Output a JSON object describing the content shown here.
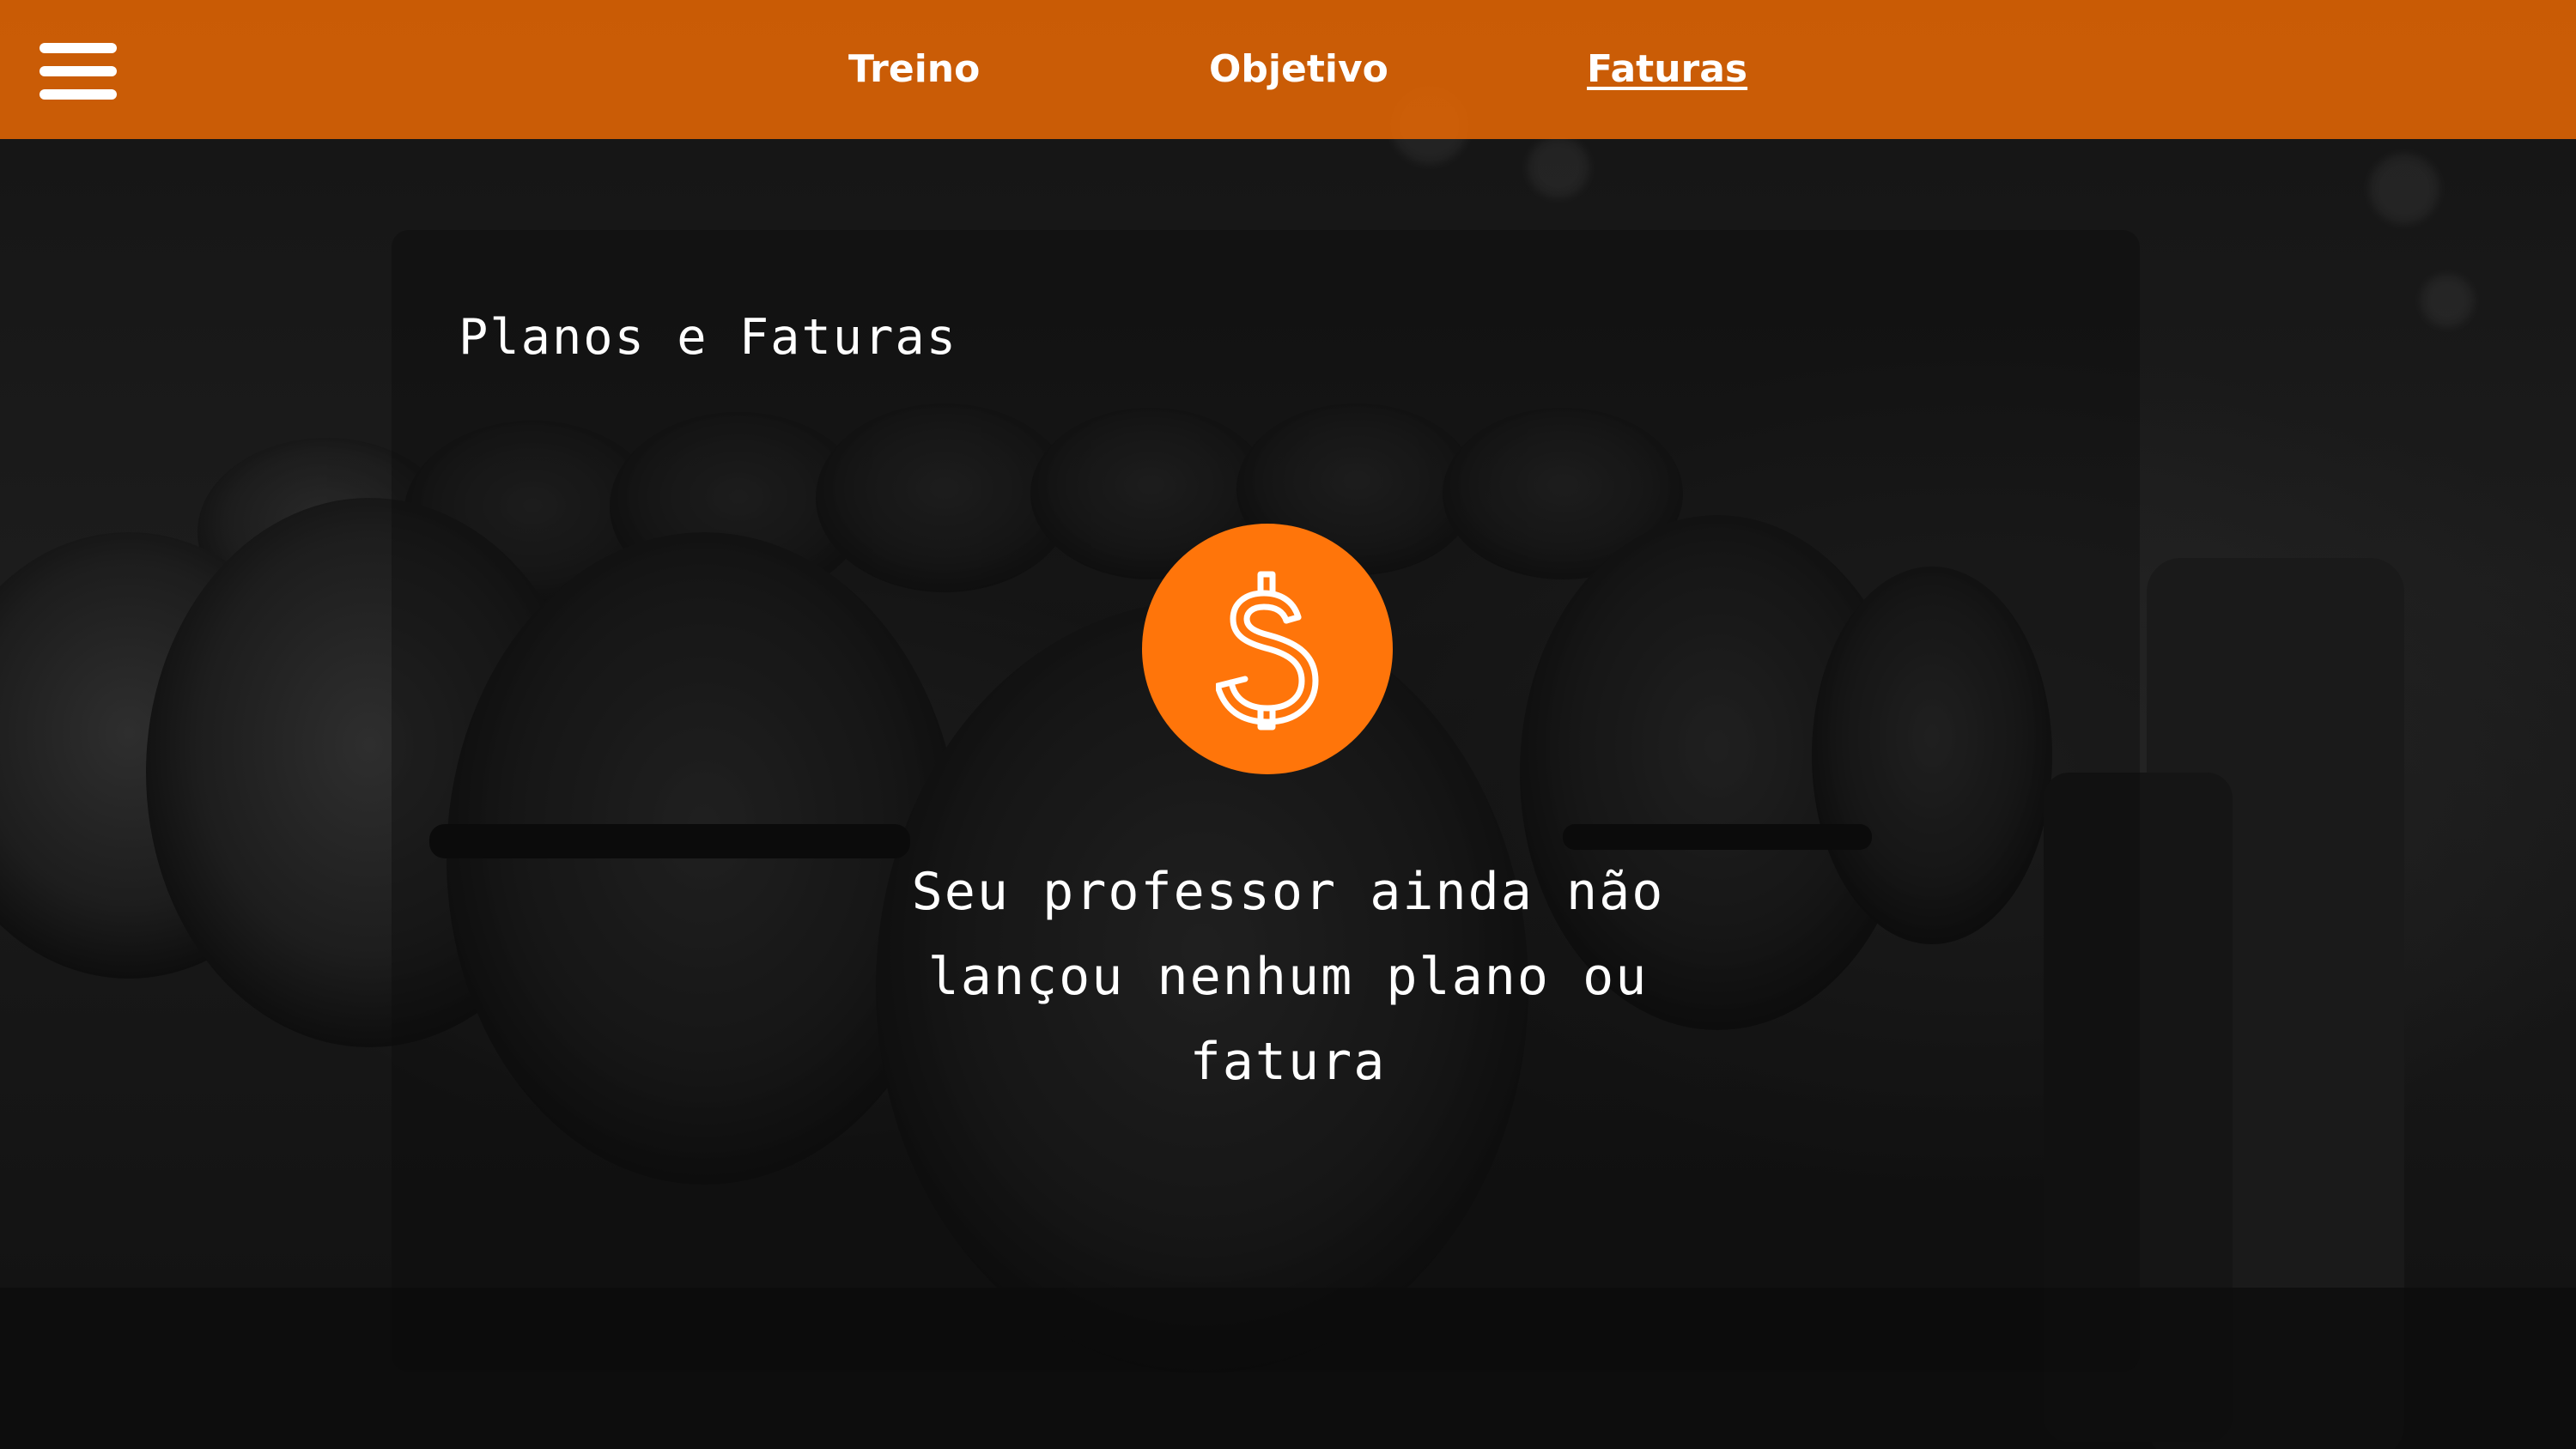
{
  "nav": {
    "menu_icon": "hamburger-menu-icon",
    "items": [
      {
        "label": "Treino"
      },
      {
        "label": "Objetivo"
      },
      {
        "label": "Faturas"
      }
    ],
    "active": "Faturas"
  },
  "page": {
    "title": "Planos e Faturas"
  },
  "empty_state": {
    "icon": "dollar-icon",
    "message": "Seu professor ainda não lançou nenhum plano ou fatura"
  },
  "colors": {
    "topbar": "#e86804",
    "accent": "#ff750a",
    "text": "#ffffff",
    "background": "#141414"
  }
}
